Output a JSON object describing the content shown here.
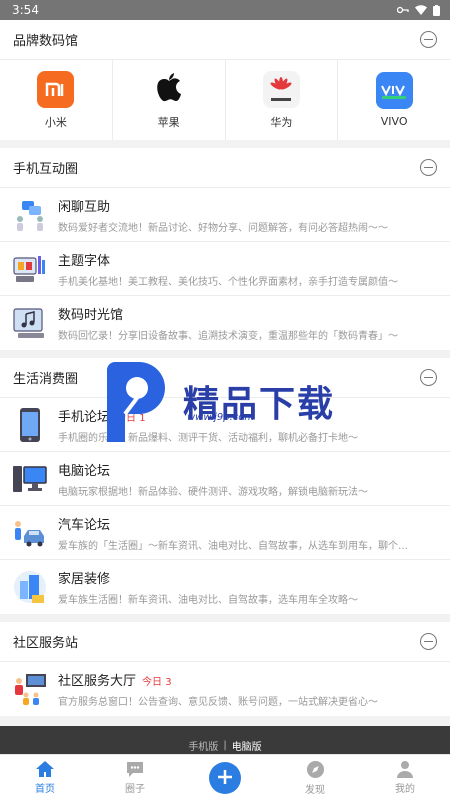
{
  "status": {
    "time": "3:54"
  },
  "brand_section": {
    "title": "品牌数码馆",
    "brands": [
      {
        "label": "小米",
        "icon": "xiaomi-logo-icon"
      },
      {
        "label": "苹果",
        "icon": "apple-logo-icon"
      },
      {
        "label": "华为",
        "icon": "huawei-logo-icon"
      },
      {
        "label": "VIVO",
        "icon": "vivo-logo-icon"
      }
    ]
  },
  "phone_section": {
    "title": "手机互动圈",
    "items": [
      {
        "name": "闲聊互助",
        "desc": "数码爱好者交流地！新品讨论、好物分享、问题解答，有问必答超热闹〜〜"
      },
      {
        "name": "主题字体",
        "desc": "手机美化基地！美工教程、美化技巧、个性化界面素材，亲手打造专属颜值〜"
      },
      {
        "name": "数码时光馆",
        "desc": "数码回忆录！分享旧设备故事、追溯技术演变，重温那些年的「数码青春」〜"
      }
    ]
  },
  "life_section": {
    "title": "生活消费圈",
    "items": [
      {
        "name": "手机论坛",
        "today": "今日 1",
        "desc": "手机圈的乐园！新品爆料、测评干货、活动福利，聊机必备打卡地〜"
      },
      {
        "name": "电脑论坛",
        "today": "",
        "desc": "电脑玩家根据地！新品体验、硬件测评、游戏攻略，解锁电脑新玩法〜"
      },
      {
        "name": "汽车论坛",
        "today": "",
        "desc": "爱车族的「生活圈」〜新车资讯、油电对比、自驾故事，从选车到用车，聊个…"
      },
      {
        "name": "家居装修",
        "today": "",
        "desc": "爱车族生活圈！新车资讯、油电对比、自驾故事，选车用车全攻略〜"
      }
    ]
  },
  "service_section": {
    "title": "社区服务站",
    "items": [
      {
        "name": "社区服务大厅",
        "today": "今日 3",
        "desc": "官方服务总窗口！公告查询、意见反馈、账号问题，一站式解决更省心〜"
      }
    ]
  },
  "footer": {
    "mobile": "手机版",
    "separator": "|",
    "desktop": "电脑版"
  },
  "tabbar": {
    "tabs": [
      {
        "label": "首页",
        "icon": "home-icon"
      },
      {
        "label": "圈子",
        "icon": "chat-icon"
      },
      {
        "label": "",
        "icon": "plus-icon"
      },
      {
        "label": "发现",
        "icon": "compass-icon"
      },
      {
        "label": "我的",
        "icon": "user-icon"
      }
    ]
  },
  "watermark": {
    "text": "精品下载",
    "url": "www.j9p.com"
  },
  "colors": {
    "accent": "#2b7de1",
    "today": "#e4393c",
    "xiaomi": "#f56b1f",
    "vivo": "#3a86f5",
    "huawei": "#e4393c"
  }
}
